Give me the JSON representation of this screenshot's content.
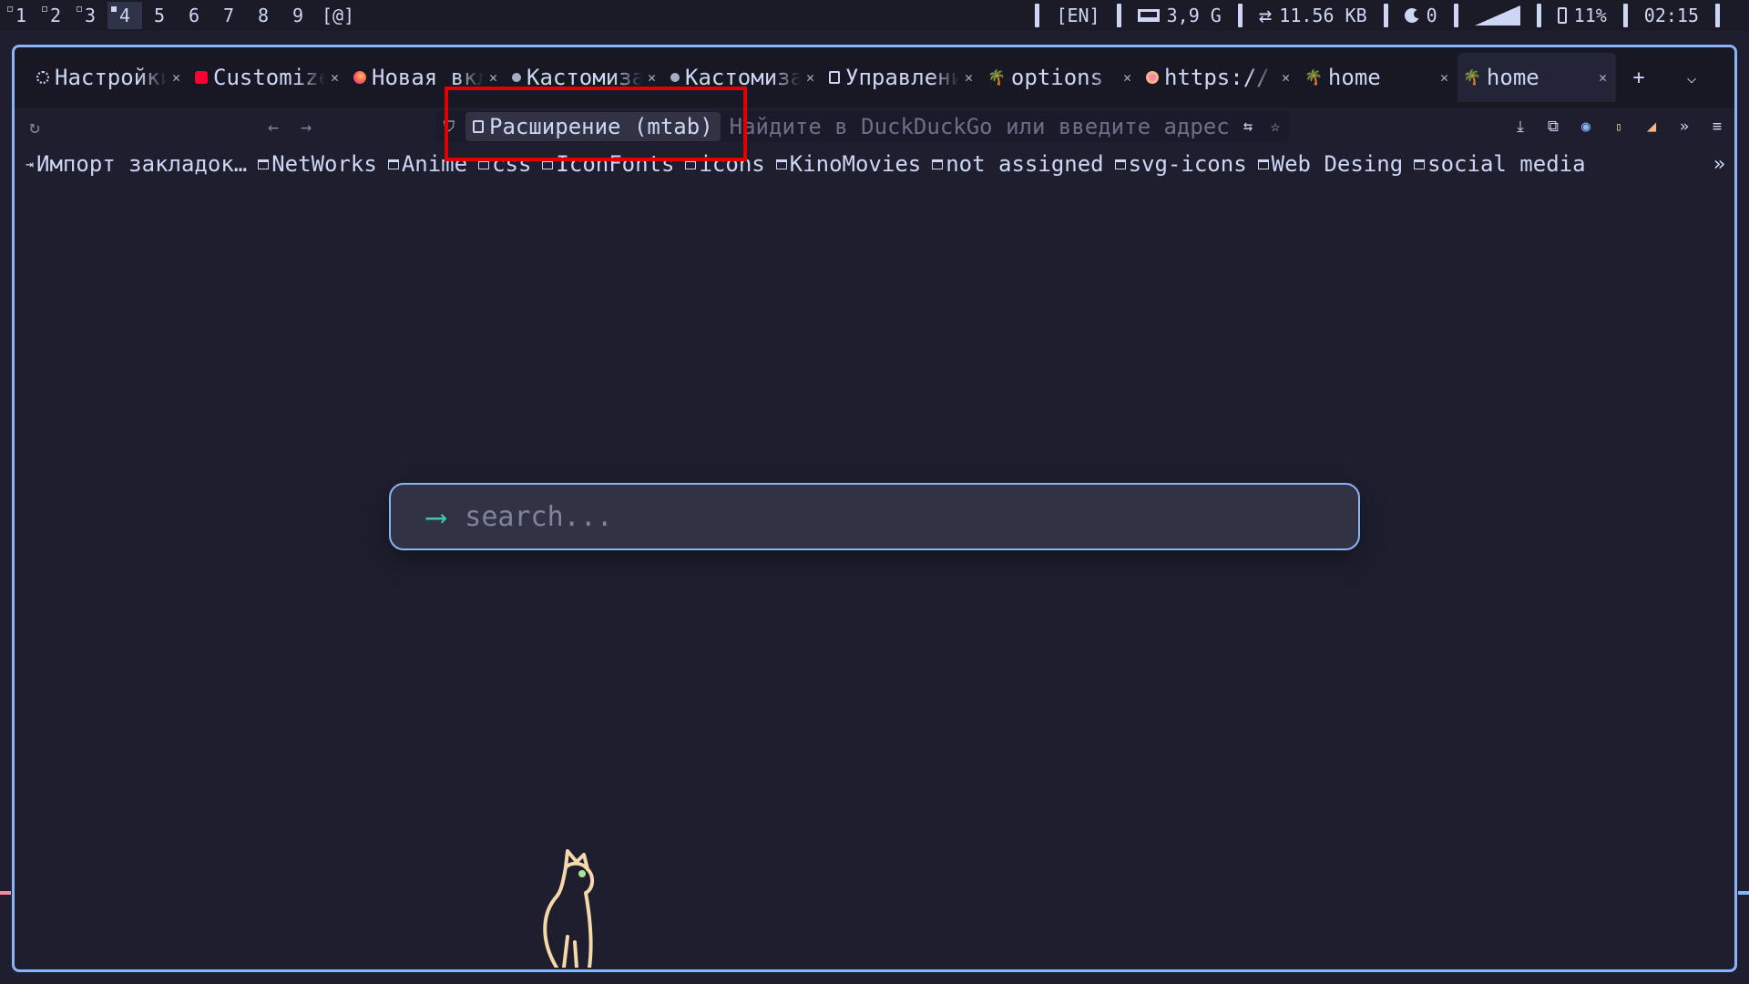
{
  "statusbar": {
    "workspaces": [
      {
        "label": "1",
        "has_windows": true,
        "active": false
      },
      {
        "label": "2",
        "has_windows": true,
        "active": false
      },
      {
        "label": "3",
        "has_windows": true,
        "active": false
      },
      {
        "label": "4",
        "has_windows": true,
        "active": true
      },
      {
        "label": "5",
        "has_windows": false,
        "active": false
      },
      {
        "label": "6",
        "has_windows": false,
        "active": false
      },
      {
        "label": "7",
        "has_windows": false,
        "active": false
      },
      {
        "label": "8",
        "has_windows": false,
        "active": false
      },
      {
        "label": "9",
        "has_windows": false,
        "active": false
      }
    ],
    "special_workspace": "[@]",
    "keyboard_layout": "[EN]",
    "ram": "3,9 G",
    "network": "11.56 KB",
    "notifications": "0",
    "battery": "11%",
    "clock": "02:15"
  },
  "tabs": [
    {
      "title": "Настройки",
      "icon": "gear-icon",
      "active": false
    },
    {
      "title": "Customize",
      "icon": "youtube-icon",
      "active": false
    },
    {
      "title": "Новая вкладка",
      "icon": "firefox-icon",
      "active": false
    },
    {
      "title": "Кастомизация",
      "icon": "dot-icon",
      "active": false
    },
    {
      "title": "Кастомизация",
      "icon": "dot-icon",
      "active": false
    },
    {
      "title": "Управление",
      "icon": "puzzle-icon",
      "active": false
    },
    {
      "title": "options",
      "icon": "palm-icon",
      "active": false
    },
    {
      "title": "https://",
      "icon": "red-circle-icon",
      "active": false
    },
    {
      "title": "home",
      "icon": "palm-icon",
      "active": false
    },
    {
      "title": "home",
      "icon": "palm-icon",
      "active": true
    }
  ],
  "urlbar": {
    "extension_label": "Расширение (mtab)",
    "placeholder": "Найдите в DuckDuckGo или введите адрес"
  },
  "bookmarks": [
    {
      "label": "Импорт закладок…",
      "type": "import"
    },
    {
      "label": "NetWorks",
      "type": "folder"
    },
    {
      "label": "Anime",
      "type": "folder"
    },
    {
      "label": "css",
      "type": "folder"
    },
    {
      "label": "IconFonts",
      "type": "folder"
    },
    {
      "label": "icons",
      "type": "folder"
    },
    {
      "label": "KinoMovies",
      "type": "folder"
    },
    {
      "label": "not assigned",
      "type": "folder"
    },
    {
      "label": "svg-icons",
      "type": "folder"
    },
    {
      "label": "Web Desing",
      "type": "folder"
    },
    {
      "label": "social media",
      "type": "folder"
    }
  ],
  "search": {
    "placeholder": "search..."
  },
  "colors": {
    "background": "#1e1e2e",
    "accent": "#89b4fa",
    "search_arrow": "#40c9a9",
    "highlight": "#e00000",
    "cat": "#f5d9a8"
  }
}
